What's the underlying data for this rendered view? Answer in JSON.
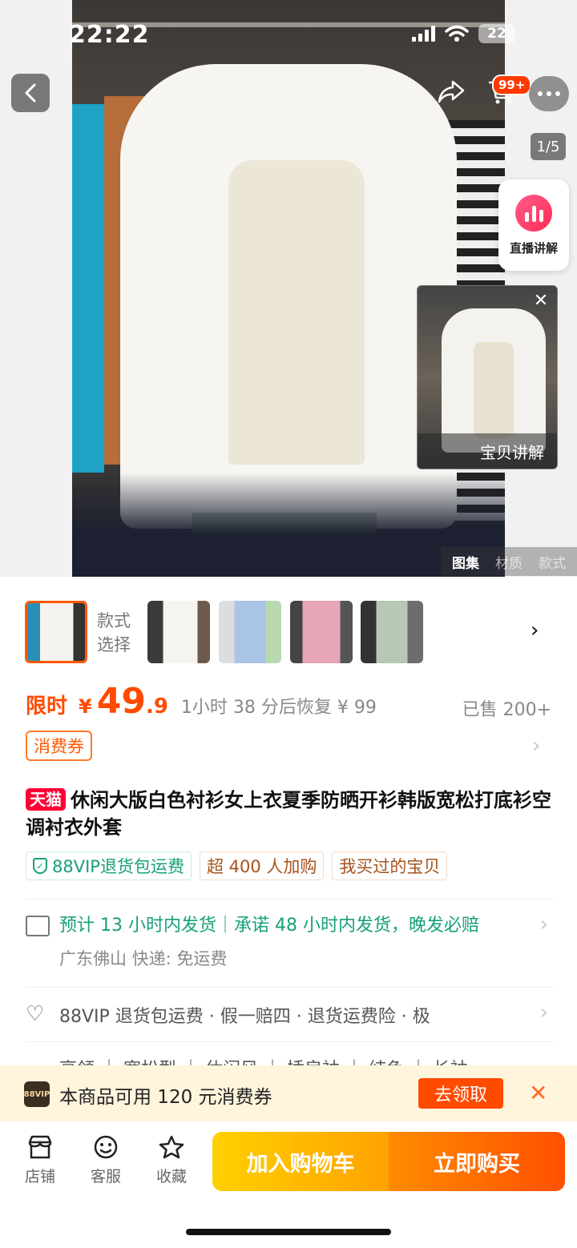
{
  "status_bar": {
    "time": "22:22",
    "battery": "22"
  },
  "header": {
    "cart_badge": "99+",
    "image_counter": "1/5"
  },
  "live": {
    "label": "直播讲解"
  },
  "video": {
    "label": "宝贝讲解"
  },
  "gallery_tabs": [
    "图集",
    "材质",
    "款式"
  ],
  "styles": {
    "label_line1": "款式",
    "label_line2": "选择"
  },
  "price": {
    "limited": "限时",
    "currency": "¥",
    "integer": "49",
    "decimal": ".9",
    "restore_text": "1小时 38 分后恢复 ¥ 99",
    "sold": "已售 200+"
  },
  "coupon_tag": "消费券",
  "title": {
    "badge": "天猫",
    "text": "休闲大版白色衬衫女上衣夏季防晒开衫韩版宽松打底衫空调衬衣外套"
  },
  "tags": [
    "88VIP退货包运费",
    "超 400 人加购",
    "我买过的宝贝"
  ],
  "shipping": {
    "main": "预计 13 小时内发货｜承诺 48 小时内发货，晚发必赔",
    "sub": "广东佛山  快递:  免运费"
  },
  "guarantee": "88VIP 退货包运费 · 假一赔四 · 退货运费险 · 极",
  "attributes": "亨领 ｜ 宽松型 ｜ 休闲风 ｜ 插肩袖 ｜ 纯色 ｜ 长袖",
  "banner": {
    "logo": "88VIP",
    "text": "本商品可用 120 元消费券",
    "button": "去领取"
  },
  "bottom_bar": {
    "store": "店铺",
    "service": "客服",
    "favorite": "收藏",
    "add_to_cart": "加入购物车",
    "buy_now": "立即购买"
  },
  "colors": {
    "accent": "#ff4b00",
    "tmall_red": "#ff0036",
    "green": "#17a07a"
  }
}
